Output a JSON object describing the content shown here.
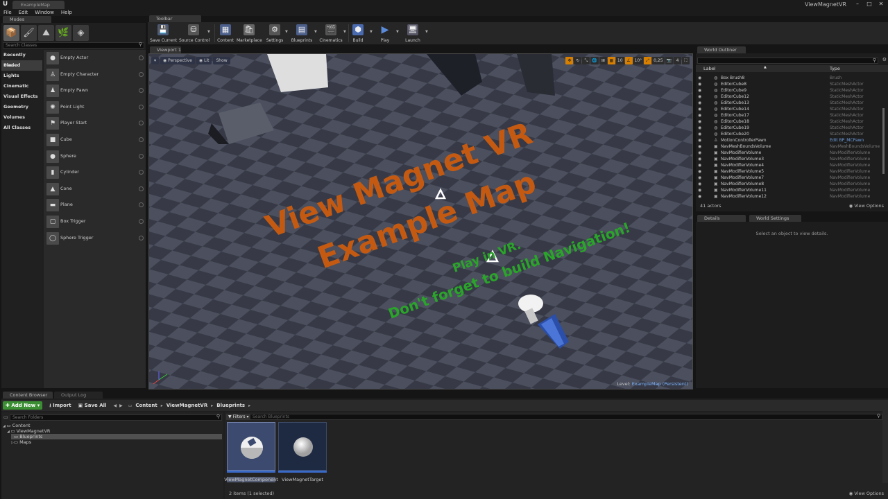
{
  "titlebar": {
    "doc_tab": "ExampleMap",
    "project_name": "ViewMagnetVR"
  },
  "menu": [
    "File",
    "Edit",
    "Window",
    "Help"
  ],
  "modes": {
    "tab": "Modes",
    "search_placeholder": "Search Classes",
    "categories": [
      "Recently Placed",
      "Basic",
      "Lights",
      "Cinematic",
      "Visual Effects",
      "Geometry",
      "Volumes",
      "All Classes"
    ],
    "items": [
      "Empty Actor",
      "Empty Character",
      "Empty Pawn",
      "Point Light",
      "Player Start",
      "Cube",
      "Sphere",
      "Cylinder",
      "Cone",
      "Plane",
      "Box Trigger",
      "Sphere Trigger"
    ]
  },
  "toolbar": {
    "tab": "Toolbar",
    "buttons": [
      "Save Current",
      "Source Control",
      "Content",
      "Marketplace",
      "Settings",
      "Blueprints",
      "Cinematics",
      "Build",
      "Play",
      "Launch"
    ]
  },
  "viewport": {
    "tab": "Viewport 1",
    "perspective": "Perspective",
    "lit": "Lit",
    "show": "Show",
    "grid_snap": "10",
    "rot_snap": "10°",
    "scale_snap": "0,25",
    "cam_speed": "4",
    "level_label": "Level:",
    "level_value": "ExampleMap (Persistent)",
    "scene_title_1": "View Magnet VR",
    "scene_title_2": "Example Map",
    "scene_note_1": "Play in VR.",
    "scene_note_2": "Don't forget to build Navigation!"
  },
  "outliner": {
    "tab": "World Outliner",
    "col_label": "Label",
    "col_type": "Type",
    "rows": [
      {
        "label": "Box Brush8",
        "type": "Brush"
      },
      {
        "label": "EditorCube8",
        "type": "StaticMeshActor"
      },
      {
        "label": "EditorCube9",
        "type": "StaticMeshActor"
      },
      {
        "label": "EditorCube12",
        "type": "StaticMeshActor"
      },
      {
        "label": "EditorCube13",
        "type": "StaticMeshActor"
      },
      {
        "label": "EditorCube14",
        "type": "StaticMeshActor"
      },
      {
        "label": "EditorCube17",
        "type": "StaticMeshActor"
      },
      {
        "label": "EditorCube18",
        "type": "StaticMeshActor"
      },
      {
        "label": "EditorCube19",
        "type": "StaticMeshActor"
      },
      {
        "label": "EditorCube20",
        "type": "StaticMeshActor"
      },
      {
        "label": "MotionControllerPawn",
        "type": "Edit BP_MCPawn"
      },
      {
        "label": "NavMeshBoundsVolume",
        "type": "NavMeshBoundsVolume"
      },
      {
        "label": "NavModifierVolume",
        "type": "NavModifierVolume"
      },
      {
        "label": "NavModifierVolume3",
        "type": "NavModifierVolume"
      },
      {
        "label": "NavModifierVolume4",
        "type": "NavModifierVolume"
      },
      {
        "label": "NavModifierVolume5",
        "type": "NavModifierVolume"
      },
      {
        "label": "NavModifierVolume7",
        "type": "NavModifierVolume"
      },
      {
        "label": "NavModifierVolume8",
        "type": "NavModifierVolume"
      },
      {
        "label": "NavModifierVolume11",
        "type": "NavModifierVolume"
      },
      {
        "label": "NavModifierVolume12",
        "type": "NavModifierVolume"
      }
    ],
    "actor_count": "41 actors",
    "view_options": "View Options"
  },
  "details": {
    "tab": "Details",
    "world_settings_tab": "World Settings",
    "empty_msg": "Select an object to view details."
  },
  "content_browser": {
    "tab": "Content Browser",
    "output_tab": "Output Log",
    "add_new": "Add New",
    "import": "Import",
    "save_all": "Save All",
    "breadcrumbs": [
      "Content",
      "ViewMagnetVR",
      "Blueprints"
    ],
    "folder_search_placeholder": "Search Folders",
    "tree": [
      "Content",
      "ViewMagnetVR",
      "Blueprints",
      "Maps"
    ],
    "filters": "Filters",
    "asset_search_placeholder": "Search Blueprints",
    "assets": [
      "ViewMagnetComponent",
      "ViewMagnetTarget"
    ],
    "count": "2 items (1 selected)",
    "view_options": "View Options"
  },
  "colors": {
    "accent_orange": "#d77f00",
    "scene_orange": "#c45a12",
    "scene_green": "#2aa52a",
    "add_new_green": "#3b8f32",
    "selection_blue": "#3a6ac8"
  }
}
